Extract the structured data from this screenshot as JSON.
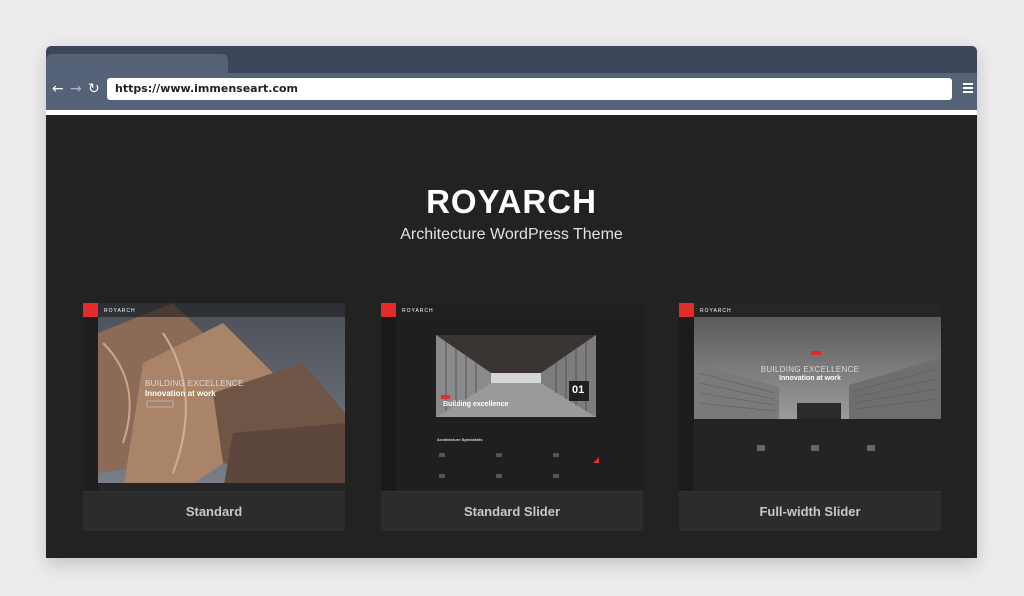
{
  "browser": {
    "url": "https://www.immenseart.com",
    "dots": [
      "#ee5b56",
      "#f6be3b",
      "#5fcf4b"
    ]
  },
  "hero": {
    "brand": "ROYARCH",
    "tagline": "Architecture WordPress Theme"
  },
  "cards": [
    {
      "label": "Standard",
      "logo": "ROYARCH",
      "headline_light": "BUILDING EXCELLENCE",
      "headline_bold": "Innovation at work"
    },
    {
      "label": "Standard Slider",
      "logo": "ROYARCH",
      "headline": "Building excellence",
      "slide_number": "01",
      "section_title": "Architecture Specialists"
    },
    {
      "label": "Full-width Slider",
      "logo": "ROYARCH",
      "headline_light": "BUILDING EXCELLENCE",
      "headline_bold": "Innovation at work"
    }
  ],
  "colors": {
    "accent": "#e22b2b",
    "page_bg": "#222223",
    "browser_chrome": "#566277"
  }
}
